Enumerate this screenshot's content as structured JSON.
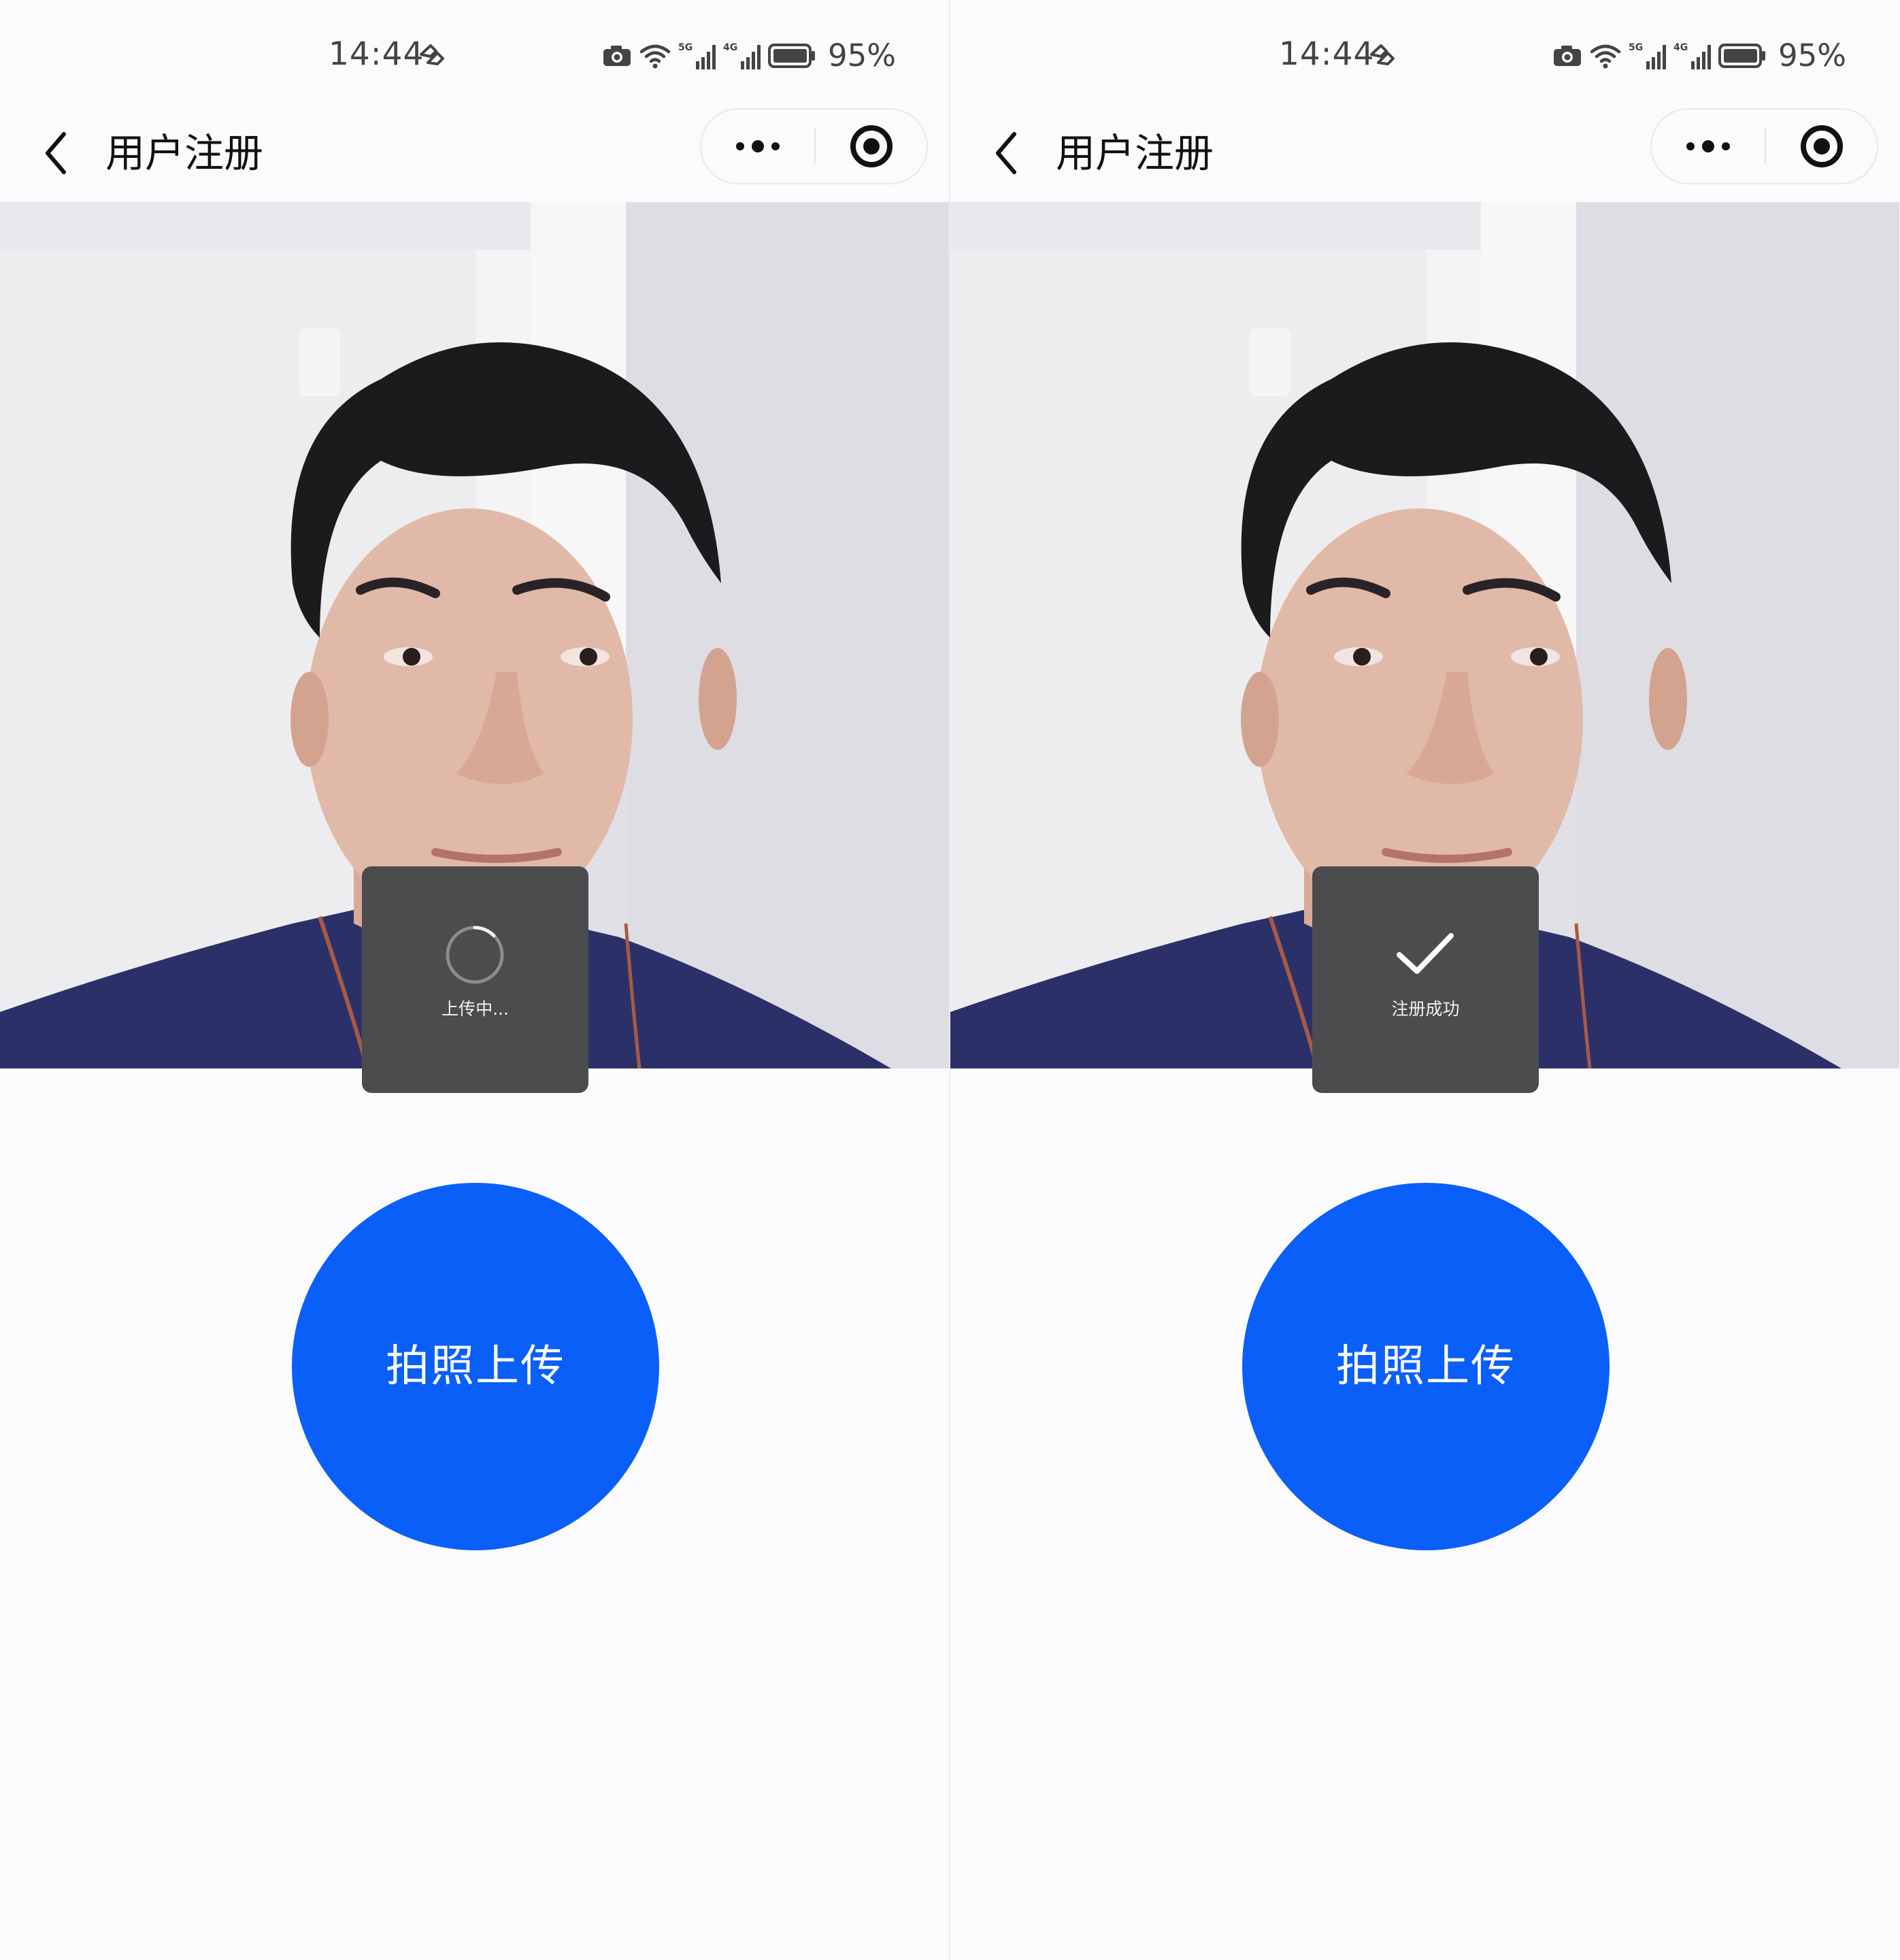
{
  "screens": [
    {
      "status": {
        "time": "14:44",
        "battery": "95%"
      },
      "nav": {
        "title": "用户注册"
      },
      "toast": {
        "type": "loading",
        "text": "上传中..."
      },
      "button": {
        "label": "拍照上传"
      }
    },
    {
      "status": {
        "time": "14:44",
        "battery": "95%"
      },
      "nav": {
        "title": "用户注册"
      },
      "toast": {
        "type": "success",
        "text": "注册成功"
      },
      "button": {
        "label": "拍照上传"
      }
    }
  ],
  "icons": {
    "back": "chevron-left-icon",
    "more": "more-dots-icon",
    "close": "mini-program-close-icon",
    "camera": "camera-icon",
    "wifi": "wifi-icon",
    "signal_5g": "signal-5g-icon",
    "signal_4g": "signal-4g-icon",
    "battery": "battery-icon",
    "spinner": "loading-spinner-icon",
    "check": "checkmark-icon"
  },
  "colors": {
    "primary_button": "#0a5ff9",
    "toast_bg": "#4c4c4e",
    "page_bg": "#fbfbfd"
  }
}
